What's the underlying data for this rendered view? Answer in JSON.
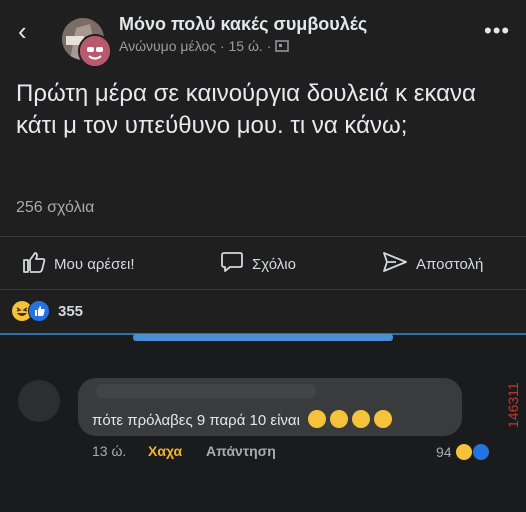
{
  "header": {
    "group_name": "Μόνο πολύ κακές συμβουλές",
    "author": "Ανώνυμο μέλος",
    "time": "15 ώ."
  },
  "post": {
    "text": "Πρώτη μέρα σε καινούργια δουλειά κ εκανα κάτι μ τον υπεύθυνο μου. τι να κάνω;",
    "comments_count": "256 σχόλια"
  },
  "actions": {
    "like": "Μου αρέσει!",
    "comment": "Σχόλιο",
    "share": "Αποστολή"
  },
  "reactions": {
    "count": "355"
  },
  "comment": {
    "text": "πότε πρόλαβες 9 παρά 10 είναι",
    "time": "13 ώ.",
    "haha": "Χαχα",
    "reply": "Απάντηση",
    "reaction_count": "94"
  },
  "watermark": "146311"
}
